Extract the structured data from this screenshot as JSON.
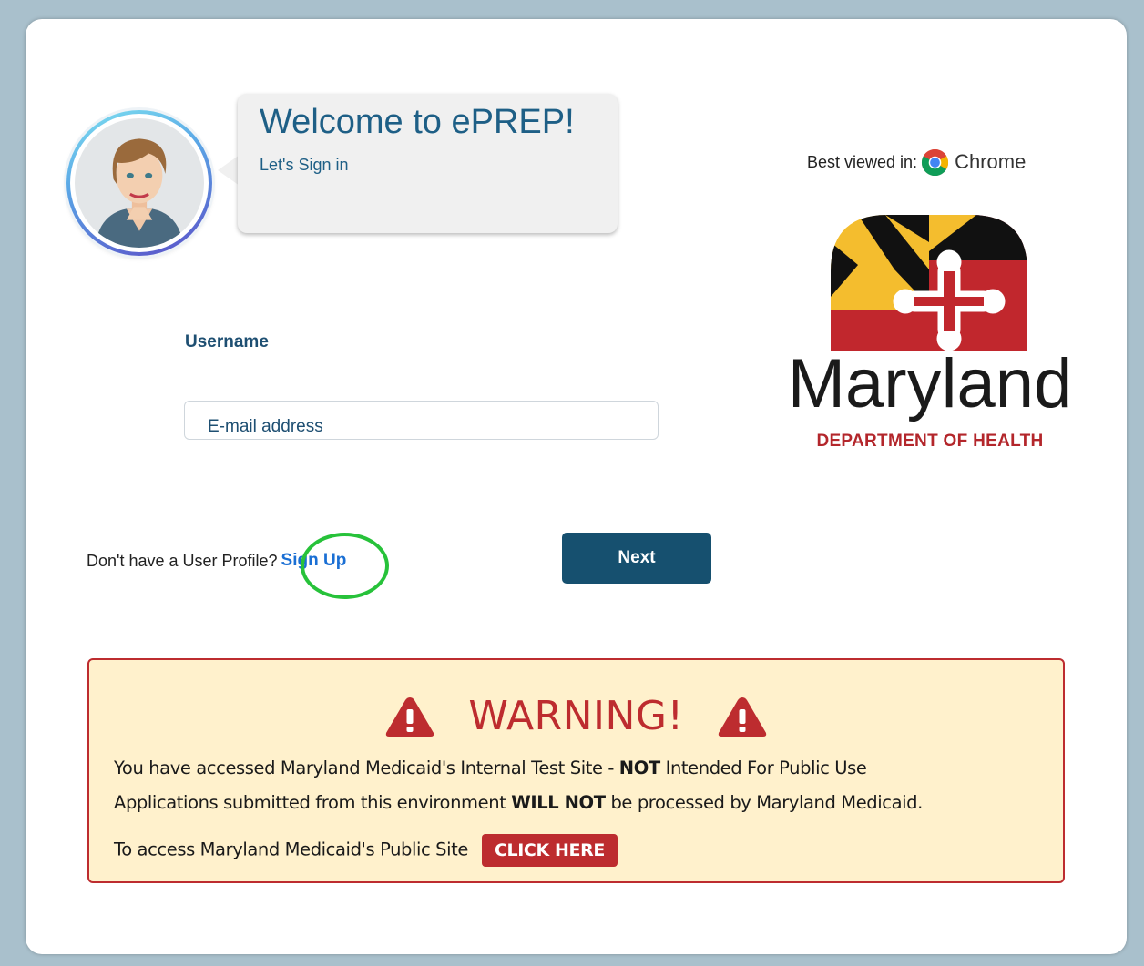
{
  "header": {
    "welcome_title": "Welcome to ePREP!",
    "welcome_subtitle": "Let's Sign in"
  },
  "browser_note": {
    "label": "Best viewed in:",
    "icon": "chrome-icon",
    "browser": "Chrome"
  },
  "logo": {
    "name": "Maryland",
    "department": "DEPARTMENT OF HEALTH"
  },
  "form": {
    "username_label": "Username",
    "email_placeholder": "E-mail address",
    "email_value": "",
    "next_label": "Next"
  },
  "signup": {
    "prompt": "Don't have a User Profile?",
    "link": "Sign Up"
  },
  "warning": {
    "title": "WARNING!",
    "line1_pre": "You have accessed Maryland Medicaid's Internal Test Site - ",
    "line1_bold": "NOT",
    "line1_post": " Intended For Public Use",
    "line2_pre": "Applications submitted from this environment ",
    "line2_bold": "WILL NOT",
    "line2_post": " be processed by Maryland Medicaid.",
    "line3_text": "To access Maryland Medicaid's Public Site",
    "button_label": "CLICK HERE"
  },
  "colors": {
    "primary": "#16506f",
    "link": "#1a6fd4",
    "warning_red": "#bd2c2f",
    "warning_bg": "#fff1cc",
    "highlight_green": "#27c23a"
  }
}
